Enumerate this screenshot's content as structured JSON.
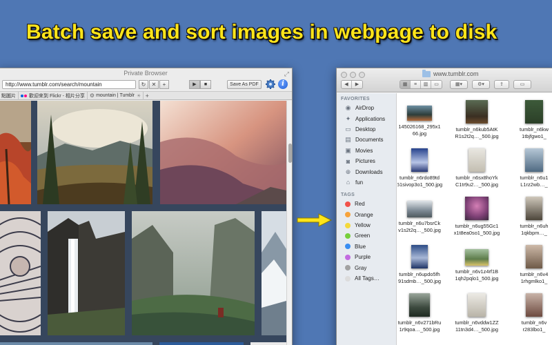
{
  "headline": "Batch save and sort images in webpage to disk",
  "browser": {
    "title": "Private Browser",
    "url": "http://www.tumblr.com/search/mountain",
    "nav_buttons": [
      "↻",
      "✕",
      "+"
    ],
    "save_pdf_label": "Save As PDF",
    "info_label": "i",
    "bookmarks": [
      {
        "label": "點圖片",
        "icon": "bookmark-icon"
      },
      {
        "label": "歡迎來到 Flickr - 相片分享",
        "icon": "flickr-icon"
      },
      {
        "label": "mountain | Tumblr",
        "icon": "tumblr-icon"
      }
    ],
    "add_bookmark_label": "+"
  },
  "finder": {
    "title": "www.tumblr.com",
    "favorites_header": "FAVORITES",
    "favorites": [
      {
        "label": "AirDrop",
        "icon": "airdrop-icon"
      },
      {
        "label": "Applications",
        "icon": "applications-icon"
      },
      {
        "label": "Desktop",
        "icon": "desktop-icon"
      },
      {
        "label": "Documents",
        "icon": "documents-icon"
      },
      {
        "label": "Movies",
        "icon": "movies-icon"
      },
      {
        "label": "Pictures",
        "icon": "pictures-icon"
      },
      {
        "label": "Downloads",
        "icon": "downloads-icon"
      },
      {
        "label": "fun",
        "icon": "home-icon"
      }
    ],
    "tags_header": "TAGS",
    "tags": [
      {
        "label": "Red",
        "color": "#f2524a"
      },
      {
        "label": "Orange",
        "color": "#f7a33b"
      },
      {
        "label": "Yellow",
        "color": "#f4d93b"
      },
      {
        "label": "Green",
        "color": "#76cf3c"
      },
      {
        "label": "Blue",
        "color": "#3a8ef2"
      },
      {
        "label": "Purple",
        "color": "#c36be0"
      },
      {
        "label": "Gray",
        "color": "#a2a2a2"
      },
      {
        "label": "All Tags…",
        "color": "#dcdcdc"
      }
    ],
    "files": [
      [
        "145026168_295x1",
        "66.jpg"
      ],
      [
        "tumblr_n6kub5AtK",
        "R1s2t2q…_500.jpg"
      ],
      [
        "tumblr_n6kw",
        "1tbjfgwo1_"
      ],
      [
        "tumblr_n6rdo89td",
        "51sivop3o1_500.jpg"
      ],
      [
        "tumblr_n6sx8hoYk",
        "C1tr9u2…_500.jpg"
      ],
      [
        "tumblr_n6u1",
        "L1rz2wb…_"
      ],
      [
        "tumblr_n6u7bsrCk",
        "v1s2t2q…_500.jpg"
      ],
      [
        "tumblr_n6ug55Gc1",
        "x1t8ea0so1_500.jpg"
      ],
      [
        "tumblr_n6uh",
        "1qkbpm…_"
      ],
      [
        "tumblr_n6updo5fh",
        "91sdmb…_500.jpg"
      ],
      [
        "tumblr_n6v1z4rf1B",
        "1qh2pqlo1_500.jpg"
      ],
      [
        "tumblr_n6v4",
        "1rhgmlko1_"
      ],
      [
        "tumblr_n6v271bRu",
        "1r9qoa…_500.jpg"
      ],
      [
        "tumblr_n6vddw1ZZ",
        "11tn3d4…_500.jpg"
      ],
      [
        "tumblr_n6v",
        "r283lbo1_"
      ]
    ]
  }
}
